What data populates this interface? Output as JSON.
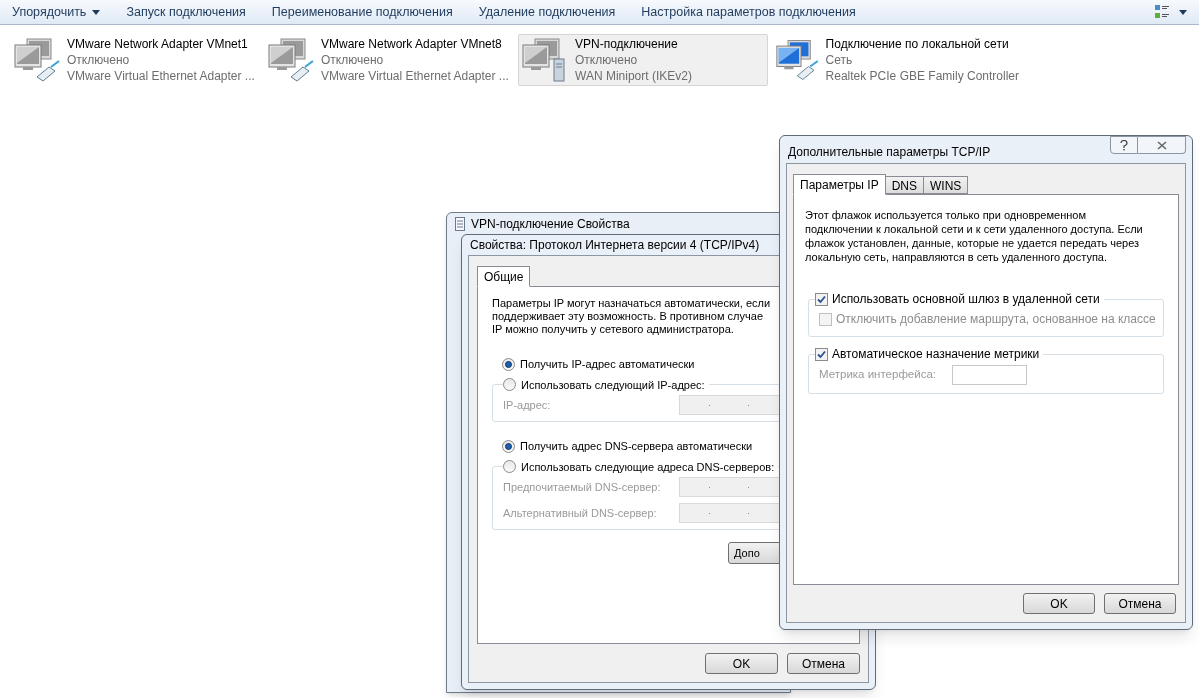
{
  "toolbar": {
    "items": [
      {
        "label": "Упорядочить",
        "kind": "dropdown"
      },
      {
        "label": "Запуск подключения",
        "kind": "button"
      },
      {
        "label": "Переименование подключения",
        "kind": "button"
      },
      {
        "label": "Удаление подключения",
        "kind": "button"
      },
      {
        "label": "Настройка параметров подключения",
        "kind": "button"
      }
    ]
  },
  "connections": [
    {
      "name": "VMware Network Adapter VMnet1",
      "status": "Отключено",
      "device": "VMware Virtual Ethernet Adapter ...",
      "kind": "ethernet",
      "connected": false,
      "selected": false
    },
    {
      "name": "VMware Network Adapter VMnet8",
      "status": "Отключено",
      "device": "VMware Virtual Ethernet Adapter ...",
      "kind": "ethernet",
      "connected": false,
      "selected": false
    },
    {
      "name": "VPN-подключение",
      "status": "Отключено",
      "device": "WAN Miniport (IKEv2)",
      "kind": "vpn",
      "connected": false,
      "selected": true
    },
    {
      "name": "Подключение по локальной сети",
      "status": "Сеть",
      "device": "Realtek PCIe GBE Family Controller",
      "kind": "ethernet",
      "connected": true,
      "selected": false
    }
  ],
  "back_window": {
    "title": "VPN-подключение Свойства"
  },
  "ipv4_dialog": {
    "title": "Свойства: Протокол Интернета версии 4 (TCP/IPv4)",
    "tabs": [
      {
        "label": "Общие",
        "selected": true
      }
    ],
    "description": "Параметры IP могут назначаться автоматически, если\nподдерживает эту возможность. В противном случае\nIP можно получить у сетевого администратора.",
    "sections": [
      {
        "auto": {
          "label": "Получить IP-адрес автоматически",
          "selected": true
        },
        "manual": {
          "label": "Использовать следующий IP-адрес:",
          "selected": false
        },
        "fields": [
          {
            "label": "IP-адрес:",
            "disabled": true
          }
        ]
      },
      {
        "auto": {
          "label": "Получить адрес DNS-сервера автоматически",
          "selected": true
        },
        "manual": {
          "label": "Использовать следующие адреса DNS-серверов:",
          "selected": false
        },
        "fields": [
          {
            "label": "Предпочитаемый DNS-сервер:",
            "disabled": true
          },
          {
            "label": "Альтернативный DNS-сервер:",
            "disabled": true
          }
        ]
      }
    ],
    "advanced_button": "Допо",
    "buttons": [
      "OK",
      "Отмена"
    ]
  },
  "tcpip_dialog": {
    "title": "Дополнительные параметры TCP/IP",
    "tabs": [
      {
        "label": "Параметры IP",
        "selected": true
      },
      {
        "label": "DNS",
        "selected": false
      },
      {
        "label": "WINS",
        "selected": false
      }
    ],
    "description": "Этот флажок используется только при одновременном подключении к локальной сети и к сети удаленного доступа. Если флажок установлен, данные, которые не удается передать через локальную сеть, направляются в сеть удаленного доступа.",
    "groups": [
      {
        "checkbox": {
          "label": "Использовать основной шлюз в удаленной сети",
          "checked": true
        },
        "item": {
          "kind": "checkbox",
          "label": "Отключить добавление маршрута, основанное на классе",
          "checked": false,
          "disabled": true
        }
      },
      {
        "checkbox": {
          "label": "Автоматическое назначение метрики",
          "checked": true
        },
        "item": {
          "kind": "field",
          "label": "Метрика интерфейса:",
          "disabled": true
        }
      }
    ],
    "buttons": [
      "OK",
      "Отмена"
    ]
  }
}
